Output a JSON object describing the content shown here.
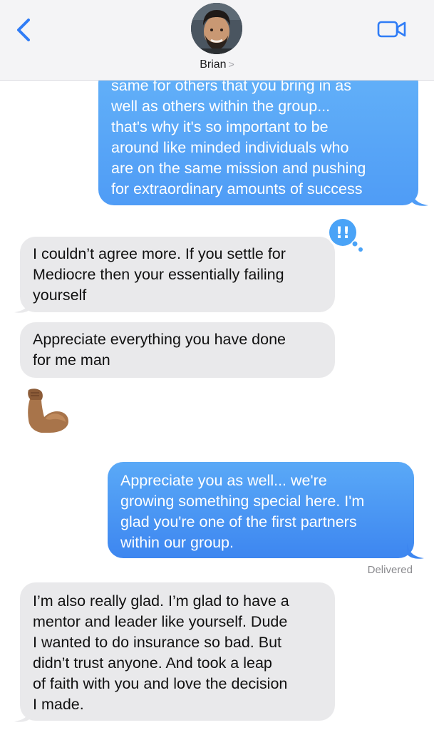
{
  "header": {
    "contact_name": "Brian",
    "back_icon": "chevron-left-icon",
    "video_icon": "video-camera-icon",
    "accent_color": "#2f7cf6"
  },
  "messages": [
    {
      "side": "sent",
      "text": "same for others that you bring in as\nwell as others within the group...\nthat's why it's so important to be\naround like minded individuals who\nare on the same mission and pushing\nfor extraordinary amounts of success"
    },
    {
      "side": "received",
      "text": "I couldn’t agree more. If you settle for\nMediocre then your essentially failing\nyourself",
      "reaction": "!!"
    },
    {
      "side": "received",
      "text": "Appreciate everything you have done\nfor me man"
    },
    {
      "side": "received",
      "emoji": "flexed-biceps"
    },
    {
      "side": "sent",
      "text": "Appreciate you as well... we're\ngrowing something special here. I'm\nglad you're one of the first partners\nwithin our group.",
      "status": "Delivered"
    },
    {
      "side": "received",
      "text": "I’m also really glad. I’m glad to have a\nmentor and leader like yourself. Dude\nI wanted to do insurance so bad. But\ndidn’t trust anyone. And took a leap\nof faith with you and love the decision\nI made."
    }
  ]
}
